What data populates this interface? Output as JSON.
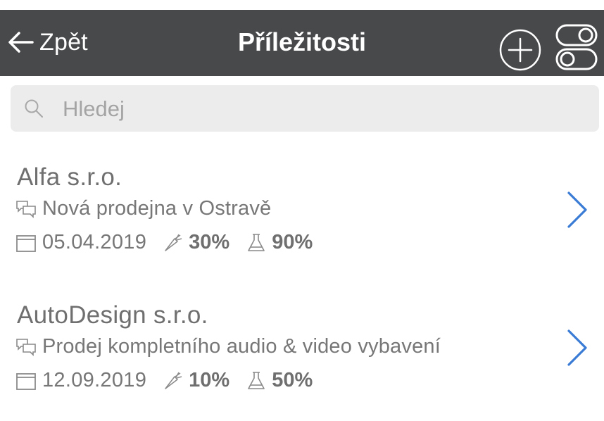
{
  "header": {
    "back_label": "Zpět",
    "title": "Příležitosti",
    "background": "#48494b",
    "icons": {
      "back": "arrow-left-icon",
      "add": "plus-circle-icon",
      "settings": "toggle-switches-icon"
    }
  },
  "search": {
    "placeholder": "Hledej",
    "value": "",
    "icon": "search-icon"
  },
  "opportunities": [
    {
      "company": "Alfa s.r.o.",
      "description": "Nová prodejna v Ostravě",
      "date": "05.04.2019",
      "progress": "30%",
      "probability": "90%"
    },
    {
      "company": "AutoDesign s.r.o.",
      "description": "Prodej kompletního audio & video vybavení",
      "date": "12.09.2019",
      "progress": "10%",
      "probability": "50%"
    }
  ],
  "colors": {
    "accent": "#3a7bd5",
    "text": "#6f6f6f",
    "search_bg": "#ececec"
  }
}
